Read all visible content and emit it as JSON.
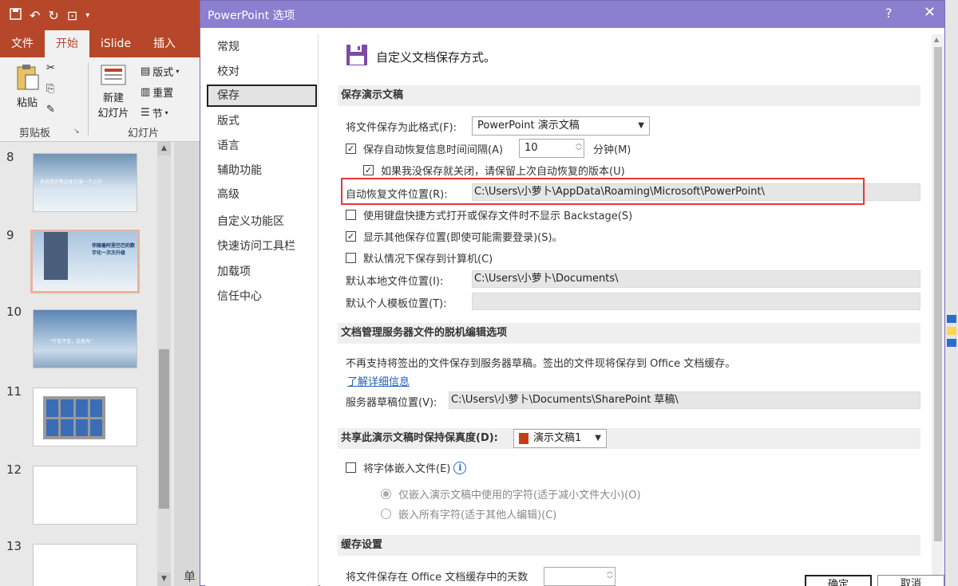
{
  "app": {
    "tabs": [
      "文件",
      "开始",
      "iSlide",
      "插入"
    ],
    "active_tab": "开始",
    "ribbon": {
      "paste": "粘贴",
      "clipboard_group": "剪贴板",
      "new_slide_1": "新建",
      "new_slide_2": "幻灯片",
      "layout": "版式",
      "reset": "重置",
      "section": "节",
      "slides_group": "幻灯片"
    },
    "slides": [
      {
        "num": "8",
        "text": "来自我的笔记本记录一个上升"
      },
      {
        "num": "9",
        "text": "伴随着阿里巴巴的数字化一次次升级"
      },
      {
        "num": "10",
        "text": "“行无不至，志者有”"
      },
      {
        "num": "11",
        "text": ""
      },
      {
        "num": "12",
        "text": ""
      },
      {
        "num": "13",
        "text": ""
      }
    ],
    "status_fragment": "单"
  },
  "dialog": {
    "title": "PowerPoint 选项",
    "help": "?",
    "close": "✕",
    "nav": [
      "常规",
      "校对",
      "保存",
      "版式",
      "语言",
      "辅助功能",
      "高级",
      "自定义功能区",
      "快速访问工具栏",
      "加载项",
      "信任中心"
    ],
    "nav_active": "保存",
    "header": "自定义文档保存方式。",
    "sections": {
      "save": "保存演示文稿",
      "offline": "文档管理服务器文件的脱机编辑选项",
      "fidelity": "共享此演示文稿时保持保真度(D):",
      "cache": "缓存设置"
    },
    "save_format_label": "将文件保存为此格式(F):",
    "save_format_value": "PowerPoint 演示文稿",
    "autorecover_label": "保存自动恢复信息时间间隔(A)",
    "autorecover_value": "10",
    "minutes_label": "分钟(M)",
    "keep_last_label": "如果我没保存就关闭，请保留上次自动恢复的版本(U)",
    "autorecover_loc_label": "自动恢复文件位置(R):",
    "autorecover_loc_value": "C:\\Users\\小萝卜\\AppData\\Roaming\\Microsoft\\PowerPoint\\",
    "no_backstage_label": "使用键盘快捷方式打开或保存文件时不显示 Backstage(S)",
    "show_other_label": "显示其他保存位置(即使可能需要登录)(S)。",
    "save_local_label": "默认情况下保存到计算机(C)",
    "local_loc_label": "默认本地文件位置(I):",
    "local_loc_value": "C:\\Users\\小萝卜\\Documents\\",
    "template_loc_label": "默认个人模板位置(T):",
    "template_loc_value": "",
    "offline_note": "不再支持将签出的文件保存到服务器草稿。签出的文件现将保存到 Office 文档缓存。",
    "learn_more": "了解详细信息",
    "server_drafts_label": "服务器草稿位置(V):",
    "server_drafts_value": "C:\\Users\\小萝卜\\Documents\\SharePoint 草稿\\",
    "fidelity_doc": "演示文稿1",
    "embed_fonts_label": "将字体嵌入文件(E)",
    "embed_only_used": "仅嵌入演示文稿中使用的字符(适于减小文件大小)(O)",
    "embed_all": "嵌入所有字符(适于其他人编辑)(C)",
    "cache_partial": "将文件保存在 Office 文档缓存中的天数",
    "ok": "确定",
    "cancel": "取消",
    "checks": {
      "autorecover": true,
      "keep_last": true,
      "no_backstage": false,
      "show_other": true,
      "save_local": false,
      "embed_fonts": false
    }
  }
}
